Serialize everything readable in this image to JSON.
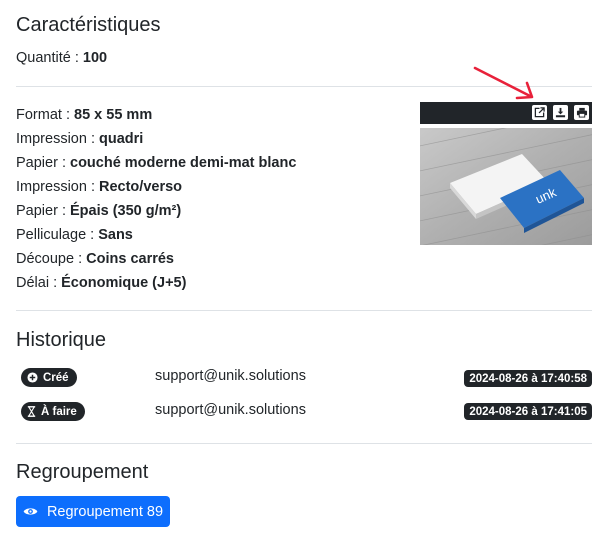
{
  "characteristics": {
    "title": "Caractéristiques",
    "quantity": {
      "label": "Quantité : ",
      "value": "100"
    },
    "specs": [
      {
        "label": "Format : ",
        "value": "85 x 55 mm"
      },
      {
        "label": "Impression : ",
        "value": "quadri"
      },
      {
        "label": "Papier : ",
        "value": "couché moderne demi-mat blanc"
      },
      {
        "label": "Impression : ",
        "value": "Recto/verso"
      },
      {
        "label": "Papier : ",
        "value": "Épais (350 g/m²)"
      },
      {
        "label": "Pelliculage : ",
        "value": "Sans"
      },
      {
        "label": "Découpe : ",
        "value": "Coins carrés"
      },
      {
        "label": "Délai : ",
        "value": "Économique (J+5)"
      }
    ],
    "preview": {
      "toolbar_icons": [
        "open-external-icon",
        "download-icon",
        "print-icon"
      ],
      "card_logo_text": "unk"
    }
  },
  "history": {
    "title": "Historique",
    "entries": [
      {
        "status": "Créé",
        "icon": "plus-circle-icon",
        "user": "support@unik.solutions",
        "timestamp": "2024-08-26 à 17:40:58"
      },
      {
        "status": "À faire",
        "icon": "hourglass-icon",
        "user": "support@unik.solutions",
        "timestamp": "2024-08-26 à 17:41:05"
      }
    ]
  },
  "grouping": {
    "title": "Regroupement",
    "button_label": "Regroupement 89",
    "button_icon": "eye-icon"
  },
  "colors": {
    "primary": "#0d6efd",
    "dark": "#212529",
    "annotation_arrow": "#e8213a"
  }
}
